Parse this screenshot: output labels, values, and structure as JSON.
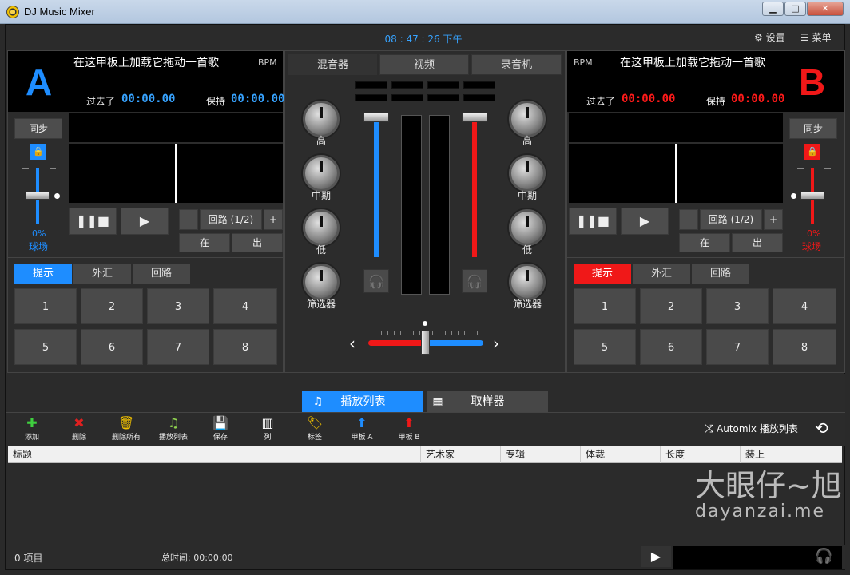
{
  "window": {
    "title": "DJ Music Mixer",
    "minimize": "▁",
    "maximize": "□",
    "close": "✕"
  },
  "topbar": {
    "clock": "08 : 47 : 26 下午",
    "settings": "设置",
    "menu": "菜单"
  },
  "deckA": {
    "letter": "A",
    "title": "在这甲板上加载它拖动一首歌",
    "bpm": "BPM",
    "elapsed_label": "过去了",
    "elapsed": "00:00.00",
    "remain_label": "保持",
    "remain": "00:00.00",
    "sync": "同步",
    "pitch_pct": "0%",
    "pitch_label": "球场",
    "loop_minus": "-",
    "loop_label": "回路 (1/2)",
    "loop_plus": "+",
    "in": "在",
    "out": "出",
    "tabs": [
      "提示",
      "外汇",
      "回路"
    ],
    "pads": [
      "1",
      "2",
      "3",
      "4",
      "5",
      "6",
      "7",
      "8"
    ]
  },
  "deckB": {
    "letter": "B",
    "title": "在这甲板上加载它拖动一首歌",
    "bpm": "BPM",
    "elapsed_label": "过去了",
    "elapsed": "00:00.00",
    "remain_label": "保持",
    "remain": "00:00.00",
    "sync": "同步",
    "pitch_pct": "0%",
    "pitch_label": "球场",
    "loop_minus": "-",
    "loop_label": "回路 (1/2)",
    "loop_plus": "+",
    "in": "在",
    "out": "出",
    "tabs": [
      "提示",
      "外汇",
      "回路"
    ],
    "pads": [
      "1",
      "2",
      "3",
      "4",
      "5",
      "6",
      "7",
      "8"
    ]
  },
  "mixer": {
    "tabs": [
      "混音器",
      "视频",
      "录音机"
    ],
    "knobs_left": [
      "高",
      "中期",
      "低",
      "筛选器"
    ],
    "knobs_right": [
      "高",
      "中期",
      "低",
      "筛选器"
    ]
  },
  "bottom": {
    "tabs": [
      "播放列表",
      "取样器"
    ],
    "tools": [
      "添加",
      "删除",
      "删除所有",
      "播放列表",
      "保存",
      "列",
      "标签",
      "甲板 A",
      "甲板 B"
    ],
    "automix": "Automix 播放列表",
    "columns": [
      "标题",
      "艺术家",
      "专辑",
      "体裁",
      "长度",
      "装上"
    ],
    "watermark": "大眼仔~旭",
    "watermark_url": "dayanzai.me",
    "status_count": "0  项目",
    "status_time": "总时间: 00:00:00"
  },
  "colors": {
    "deckA": "#1e8dff",
    "deckB": "#f01818",
    "clock": "#37a3ff"
  }
}
